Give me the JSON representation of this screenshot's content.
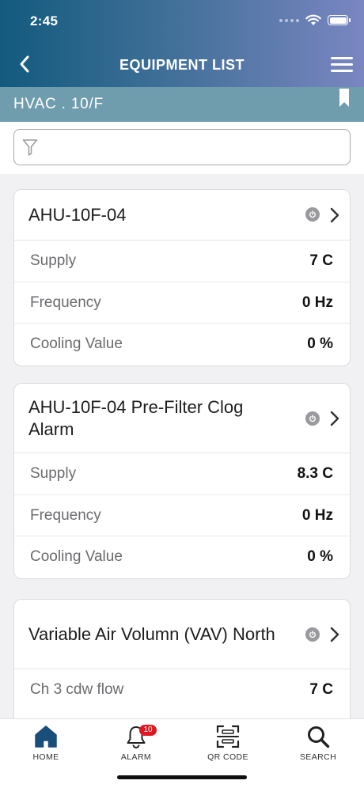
{
  "status_bar": {
    "time": "2:45"
  },
  "nav": {
    "title": "EQUIPMENT LIST"
  },
  "location": {
    "label": "HVAC . 10/F"
  },
  "filter": {
    "placeholder": "",
    "value": ""
  },
  "equipment": [
    {
      "name": "AHU-10F-04",
      "rows": [
        {
          "label": "Supply",
          "value": "7 C"
        },
        {
          "label": "Frequency",
          "value": "0 Hz"
        },
        {
          "label": "Cooling Value",
          "value": "0 %"
        }
      ]
    },
    {
      "name": "AHU-10F-04 Pre-Filter Clog Alarm",
      "rows": [
        {
          "label": "Supply",
          "value": "8.3 C"
        },
        {
          "label": "Frequency",
          "value": "0 Hz"
        },
        {
          "label": "Cooling Value",
          "value": "0 %"
        }
      ]
    },
    {
      "name": "Variable Air Volumn (VAV) North",
      "rows": [
        {
          "label": "Ch 3 cdw flow",
          "value": "7 C"
        }
      ]
    }
  ],
  "tabbar": {
    "items": [
      {
        "label": "HOME",
        "icon": "home-icon",
        "active": true
      },
      {
        "label": "ALARM",
        "icon": "bell-icon",
        "badge": "10"
      },
      {
        "label": "QR CODE",
        "icon": "qr-scan-icon"
      },
      {
        "label": "SEARCH",
        "icon": "search-icon"
      }
    ]
  },
  "colors": {
    "header_gradient_start": "#135a7e",
    "header_gradient_end": "#7a86c1",
    "location_bar": "#6f9dae",
    "active_tab": "#1a4e7a",
    "badge": "#e0161f"
  }
}
